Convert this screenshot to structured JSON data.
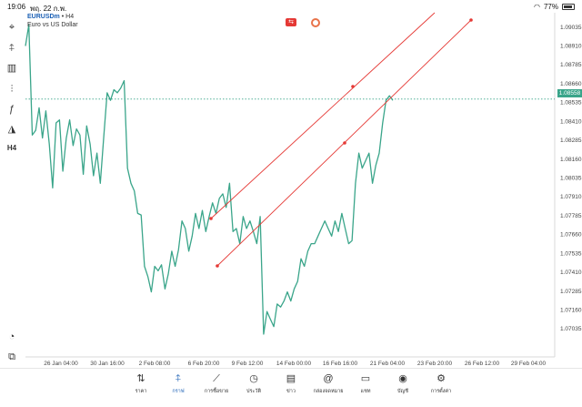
{
  "status_bar": {
    "time": "19:06",
    "date": "พฤ. 22 ก.พ.",
    "battery": "77%"
  },
  "symbol": {
    "name": "EURUSDm",
    "timeframe": "• H4",
    "description": "Euro vs US Dollar"
  },
  "left_tools": [
    {
      "icon": "crosshair-icon",
      "glyph": "⌖"
    },
    {
      "icon": "candles-icon",
      "glyph": "⍏"
    },
    {
      "icon": "volume-icon",
      "glyph": "▥"
    },
    {
      "icon": "indicators-icon",
      "glyph": "⫶"
    },
    {
      "icon": "function-icon",
      "glyph": "ƒ"
    },
    {
      "icon": "objects-icon",
      "glyph": "◮"
    },
    {
      "icon": "timeframe-icon",
      "glyph": "H4"
    },
    {
      "icon": "zoom-icon",
      "glyph": "◔"
    },
    {
      "icon": "exness-icon",
      "glyph": "⧉"
    }
  ],
  "y_axis": {
    "labels": [
      "1.09035",
      "1.08910",
      "1.08785",
      "1.08660",
      "1.08535",
      "1.08410",
      "1.08285",
      "1.08160",
      "1.08035",
      "1.07910",
      "1.07785",
      "1.07660",
      "1.07535",
      "1.07410",
      "1.07285",
      "1.07160",
      "1.07035"
    ],
    "current_price": "1.08558"
  },
  "x_axis": {
    "labels": [
      "26 Jan 04:00",
      "30 Jan 16:00",
      "2 Feb 08:00",
      "6 Feb 20:00",
      "9 Feb 12:00",
      "14 Feb 00:00",
      "16 Feb 16:00",
      "21 Feb 04:00",
      "23 Feb 20:00",
      "26 Feb 12:00",
      "29 Feb 04:00"
    ]
  },
  "chart_data": {
    "type": "line",
    "series": [
      {
        "values": [
          1.0891,
          1.0905,
          1.0832,
          1.0835,
          1.085,
          1.083,
          1.0848,
          1.0826,
          1.0797,
          1.084,
          1.0842,
          1.0808,
          1.083,
          1.0842,
          1.0825,
          1.0836,
          1.0832,
          1.0806,
          1.0838,
          1.0826,
          1.0805,
          1.082,
          1.08,
          1.083,
          1.086,
          1.0855,
          1.0862,
          1.086,
          1.0863,
          1.0868,
          1.081,
          1.08,
          1.0795,
          1.078,
          1.0779,
          1.0745,
          1.0738,
          1.0728,
          1.0745,
          1.0742,
          1.0746,
          1.073,
          1.074,
          1.0755,
          1.0745,
          1.0756,
          1.0775,
          1.077,
          1.0755,
          1.0765,
          1.078,
          1.077,
          1.0782,
          1.0768,
          1.0778,
          1.0787,
          1.078,
          1.079,
          1.0793,
          1.0784,
          1.08,
          1.0768,
          1.077,
          1.076,
          1.0778,
          1.077,
          1.0775,
          1.0768,
          1.076,
          1.0778,
          1.07,
          1.0715,
          1.071,
          1.0705,
          1.072,
          1.0718,
          1.0722,
          1.0728,
          1.0722,
          1.073,
          1.0735,
          1.075,
          1.0745,
          1.0755,
          1.076,
          1.076,
          1.0765,
          1.077,
          1.0775,
          1.077,
          1.0765,
          1.0775,
          1.0768,
          1.078,
          1.077,
          1.076,
          1.0762,
          1.08,
          1.082,
          1.081,
          1.0815,
          1.082,
          1.08,
          1.0812,
          1.082,
          1.084,
          1.0855,
          1.0858,
          1.0855
        ]
      }
    ],
    "y_range": [
      1.0697,
      1.091
    ],
    "x_labels": [
      "26 Jan 04:00",
      "30 Jan 16:00",
      "2 Feb 08:00",
      "6 Feb 20:00",
      "9 Feb 12:00",
      "14 Feb 00:00",
      "16 Feb 16:00",
      "21 Feb 04:00",
      "23 Feb 20:00",
      "26 Feb 12:00",
      "29 Feb 04:00"
    ],
    "current_price": 1.08558,
    "grid": false,
    "annotations": [
      {
        "type": "trend_line",
        "color": "#e53935"
      },
      {
        "type": "trend_line",
        "color": "#e53935"
      }
    ]
  },
  "bottom_nav": [
    {
      "label": "ราคา",
      "icon": "quotes-icon",
      "glyph": "⇅",
      "active": false
    },
    {
      "label": "กราฟ",
      "icon": "chart-icon",
      "glyph": "⍏",
      "active": true
    },
    {
      "label": "การซื้อขาย",
      "icon": "trade-icon",
      "glyph": "⟋",
      "active": false
    },
    {
      "label": "ประวัติ",
      "icon": "history-icon",
      "glyph": "◷",
      "active": false
    },
    {
      "label": "ข่าว",
      "icon": "news-icon",
      "glyph": "▤",
      "active": false
    },
    {
      "label": "กล่องจดหมาย",
      "icon": "mailbox-icon",
      "glyph": "@",
      "active": false
    },
    {
      "label": "แชท",
      "icon": "chat-icon",
      "glyph": "▭",
      "active": false
    },
    {
      "label": "บัญชี",
      "icon": "account-icon",
      "glyph": "◉",
      "active": false
    },
    {
      "label": "การตั้งค่า",
      "icon": "settings-icon",
      "glyph": "⚙",
      "active": false
    }
  ],
  "colors": {
    "line": "#3aa58a",
    "trend": "#e53935",
    "accent": "#1a5fb4"
  }
}
